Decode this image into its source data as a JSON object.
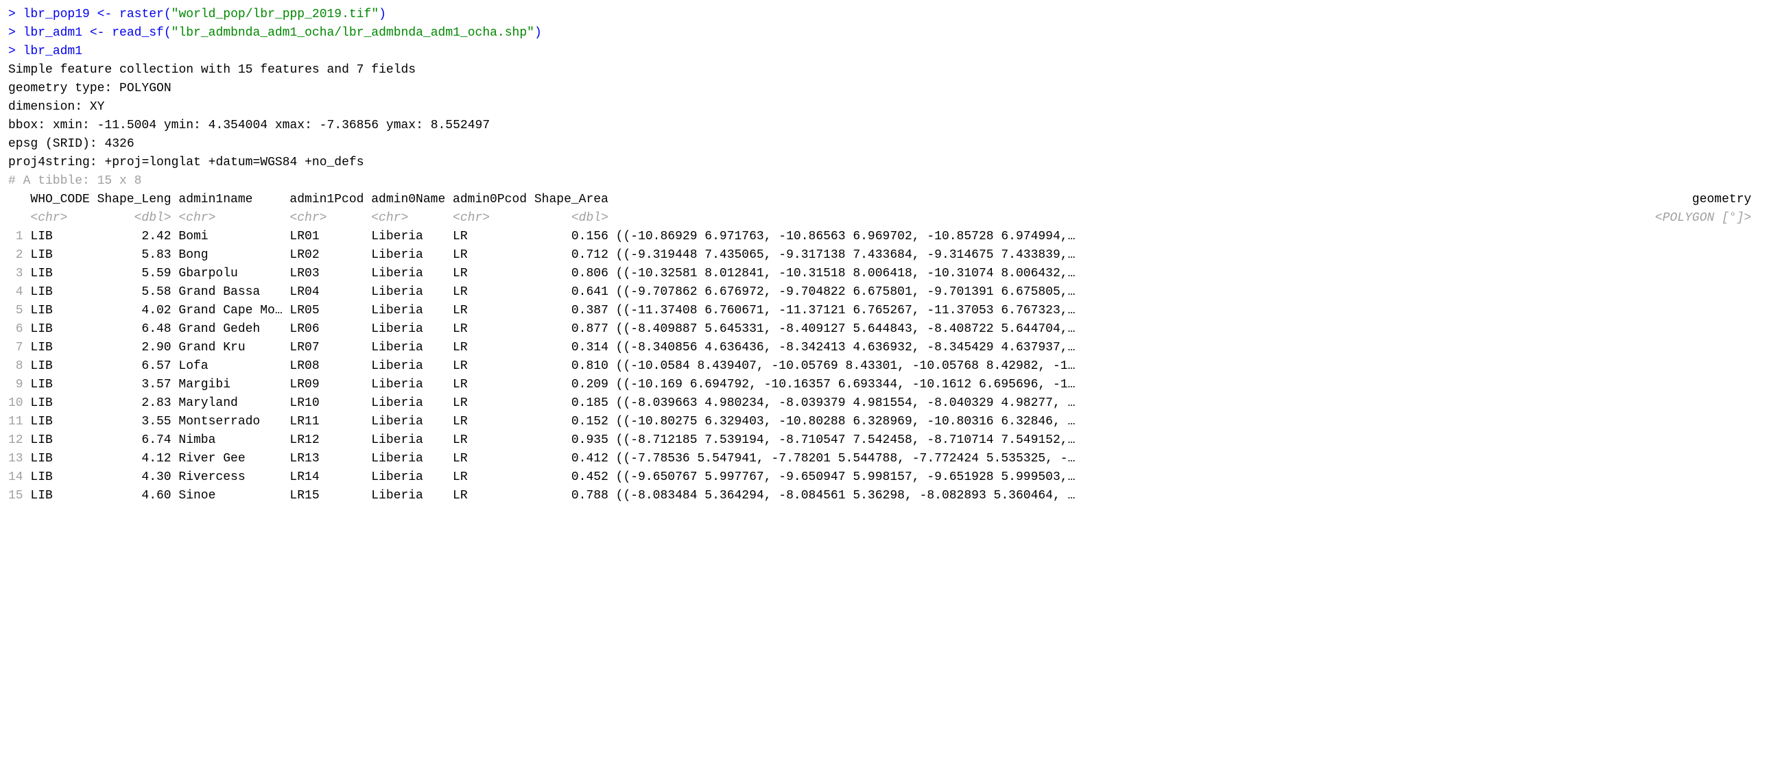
{
  "console": {
    "line1_prompt": "> ",
    "line1_var": "lbr_pop19 ",
    "line1_assign": "<- ",
    "line1_func": "raster(",
    "line1_str": "\"world_pop/lbr_ppp_2019.tif\"",
    "line1_close": ")",
    "line2_prompt": "> ",
    "line2_var": "lbr_adm1  ",
    "line2_assign": "<- ",
    "line2_func": "read_sf(",
    "line2_str": "\"lbr_admbnda_adm1_ocha/lbr_admbnda_adm1_ocha.shp\"",
    "line2_close": ")",
    "line3_prompt": "> ",
    "line3_var": "lbr_adm1"
  },
  "sf_header": {
    "line1": "Simple feature collection with 15 features and 7 fields",
    "geom_type_label": "geometry type:  ",
    "geom_type_value": "POLYGON",
    "dimension_label": "dimension:      ",
    "dimension_value": "XY",
    "bbox_label": "bbox:           ",
    "bbox_value": "xmin: -11.5004 ymin: 4.354004 xmax: -7.36856 ymax: 8.552497",
    "epsg_label": "epsg (SRID):    ",
    "epsg_value": "4326",
    "proj4_label": "proj4string:    ",
    "proj4_value": "+proj=longlat +datum=WGS84 +no_defs"
  },
  "tibble": {
    "comment_line": "# A tibble: 15 x 8",
    "headers": {
      "who": "WHO_CODE",
      "leng": "Shape_Leng",
      "name": "admin1name",
      "pcod1": "admin1Pcod",
      "admin0": "admin0Name",
      "pcod0": "admin0Pcod",
      "area": "Shape_Area",
      "geom": "geometry"
    },
    "types": {
      "who": "<chr>",
      "leng": "<dbl>",
      "name": "<chr>",
      "pcod1": "<chr>",
      "admin0": "<chr>",
      "pcod0": "<chr>",
      "area": "<dbl>",
      "geom": "<POLYGON [°]>"
    },
    "rows": [
      {
        "n": "1",
        "who": "LIB",
        "leng": "2.42",
        "name": "Bomi",
        "pcod1": "LR01",
        "admin0": "Liberia",
        "pcod0": "LR",
        "area": "0.156",
        "geom": "((-10.86929 6.971763, -10.86563 6.969702, -10.85728 6.974994,…"
      },
      {
        "n": "2",
        "who": "LIB",
        "leng": "5.83",
        "name": "Bong",
        "pcod1": "LR02",
        "admin0": "Liberia",
        "pcod0": "LR",
        "area": "0.712",
        "geom": "((-9.319448 7.435065, -9.317138 7.433684, -9.314675 7.433839,…"
      },
      {
        "n": "3",
        "who": "LIB",
        "leng": "5.59",
        "name": "Gbarpolu",
        "pcod1": "LR03",
        "admin0": "Liberia",
        "pcod0": "LR",
        "area": "0.806",
        "geom": "((-10.32581 8.012841, -10.31518 8.006418, -10.31074 8.006432,…"
      },
      {
        "n": "4",
        "who": "LIB",
        "leng": "5.58",
        "name": "Grand Bassa",
        "pcod1": "LR04",
        "admin0": "Liberia",
        "pcod0": "LR",
        "area": "0.641",
        "geom": "((-9.707862 6.676972, -9.704822 6.675801, -9.701391 6.675805,…"
      },
      {
        "n": "5",
        "who": "LIB",
        "leng": "4.02",
        "name": "Grand Cape Mo…",
        "pcod1": "LR05",
        "admin0": "Liberia",
        "pcod0": "LR",
        "area": "0.387",
        "geom": "((-11.37408 6.760671, -11.37121 6.765267, -11.37053 6.767323,…"
      },
      {
        "n": "6",
        "who": "LIB",
        "leng": "6.48",
        "name": "Grand Gedeh",
        "pcod1": "LR06",
        "admin0": "Liberia",
        "pcod0": "LR",
        "area": "0.877",
        "geom": "((-8.409887 5.645331, -8.409127 5.644843, -8.408722 5.644704,…"
      },
      {
        "n": "7",
        "who": "LIB",
        "leng": "2.90",
        "name": "Grand Kru",
        "pcod1": "LR07",
        "admin0": "Liberia",
        "pcod0": "LR",
        "area": "0.314",
        "geom": "((-8.340856 4.636436, -8.342413 4.636932, -8.345429 4.637937,…"
      },
      {
        "n": "8",
        "who": "LIB",
        "leng": "6.57",
        "name": "Lofa",
        "pcod1": "LR08",
        "admin0": "Liberia",
        "pcod0": "LR",
        "area": "0.810",
        "geom": "((-10.0584 8.439407, -10.05769 8.43301, -10.05768 8.42982, -1…"
      },
      {
        "n": "9",
        "who": "LIB",
        "leng": "3.57",
        "name": "Margibi",
        "pcod1": "LR09",
        "admin0": "Liberia",
        "pcod0": "LR",
        "area": "0.209",
        "geom": "((-10.169 6.694792, -10.16357 6.693344, -10.1612 6.695696, -1…"
      },
      {
        "n": "10",
        "who": "LIB",
        "leng": "2.83",
        "name": "Maryland",
        "pcod1": "LR10",
        "admin0": "Liberia",
        "pcod0": "LR",
        "area": "0.185",
        "geom": "((-8.039663 4.980234, -8.039379 4.981554, -8.040329 4.98277, …"
      },
      {
        "n": "11",
        "who": "LIB",
        "leng": "3.55",
        "name": "Montserrado",
        "pcod1": "LR11",
        "admin0": "Liberia",
        "pcod0": "LR",
        "area": "0.152",
        "geom": "((-10.80275 6.329403, -10.80288 6.328969, -10.80316 6.32846, …"
      },
      {
        "n": "12",
        "who": "LIB",
        "leng": "6.74",
        "name": "Nimba",
        "pcod1": "LR12",
        "admin0": "Liberia",
        "pcod0": "LR",
        "area": "0.935",
        "geom": "((-8.712185 7.539194, -8.710547 7.542458, -8.710714 7.549152,…"
      },
      {
        "n": "13",
        "who": "LIB",
        "leng": "4.12",
        "name": "River Gee",
        "pcod1": "LR13",
        "admin0": "Liberia",
        "pcod0": "LR",
        "area": "0.412",
        "geom": "((-7.78536 5.547941, -7.78201 5.544788, -7.772424 5.535325, -…"
      },
      {
        "n": "14",
        "who": "LIB",
        "leng": "4.30",
        "name": "Rivercess",
        "pcod1": "LR14",
        "admin0": "Liberia",
        "pcod0": "LR",
        "area": "0.452",
        "geom": "((-9.650767 5.997767, -9.650947 5.998157, -9.651928 5.999503,…"
      },
      {
        "n": "15",
        "who": "LIB",
        "leng": "4.60",
        "name": "Sinoe",
        "pcod1": "LR15",
        "admin0": "Liberia",
        "pcod0": "LR",
        "area": "0.788",
        "geom": "((-8.083484 5.364294, -8.084561 5.36298, -8.082893 5.360464, …"
      }
    ]
  }
}
